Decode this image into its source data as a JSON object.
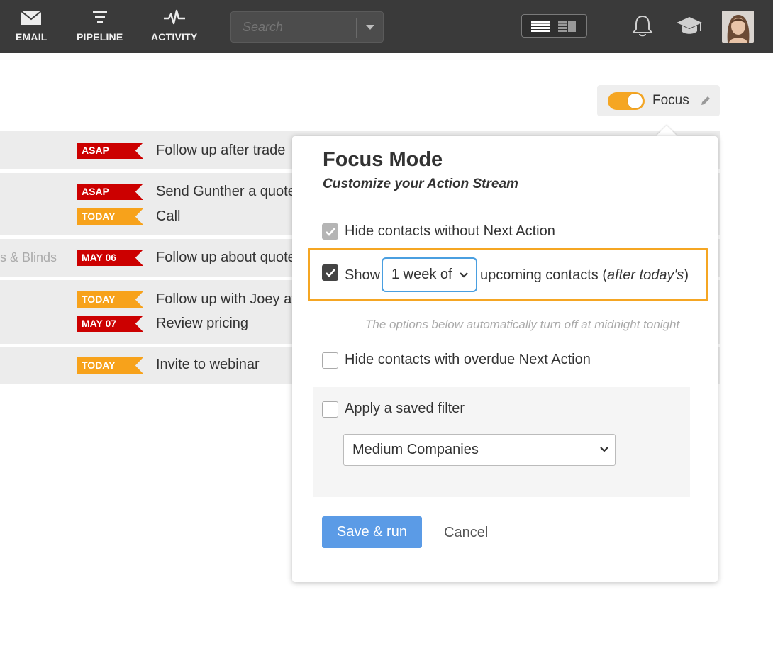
{
  "nav": {
    "email_label": "EMAIL",
    "pipeline_label": "PIPELINE",
    "activity_label": "ACTIVITY"
  },
  "search": {
    "placeholder": "Search"
  },
  "focus": {
    "label": "Focus",
    "enabled": true,
    "toggle_color": "#f5a623"
  },
  "action_stream": {
    "rows": [
      {
        "company": "",
        "items": [
          {
            "tag": "ASAP",
            "tag_color": "#cc0000",
            "task": "Follow up after trade"
          }
        ]
      },
      {
        "company": "",
        "items": [
          {
            "tag": "ASAP",
            "tag_color": "#cc0000",
            "task": "Send Gunther a quote"
          },
          {
            "tag": "TODAY",
            "tag_color": "#f7a21b",
            "task": "Call"
          }
        ]
      },
      {
        "company": "s & Blinds",
        "items": [
          {
            "tag": "MAY 06",
            "tag_color": "#cc0000",
            "task": "Follow up about quote"
          }
        ]
      },
      {
        "company": "",
        "items": [
          {
            "tag": "TODAY",
            "tag_color": "#f7a21b",
            "task": "Follow up with Joey at"
          },
          {
            "tag": "MAY 07",
            "tag_color": "#cc0000",
            "task": "Review pricing"
          }
        ]
      },
      {
        "company": "",
        "items": [
          {
            "tag": "TODAY",
            "tag_color": "#f7a21b",
            "task": "Invite to webinar"
          }
        ]
      }
    ]
  },
  "popover": {
    "title": "Focus Mode",
    "subtitle": "Customize your Action Stream",
    "hide_no_action": {
      "label": "Hide contacts without Next Action",
      "checked": true,
      "disabled": true
    },
    "show_upcoming": {
      "prefix": "Show",
      "select_value": "1 week of",
      "suffix": "upcoming contacts (",
      "suffix_italic": "after today's",
      "suffix_end": ")",
      "checked": true
    },
    "separator_text": "The options below automatically turn off at midnight tonight",
    "hide_overdue": {
      "label": "Hide contacts with overdue Next Action",
      "checked": false
    },
    "saved_filter": {
      "label": "Apply a saved filter",
      "checked": false,
      "select_value": "Medium Companies"
    },
    "save_label": "Save & run",
    "cancel_label": "Cancel",
    "highlight_color": "#f5a623",
    "button_color": "#5b9be6"
  }
}
